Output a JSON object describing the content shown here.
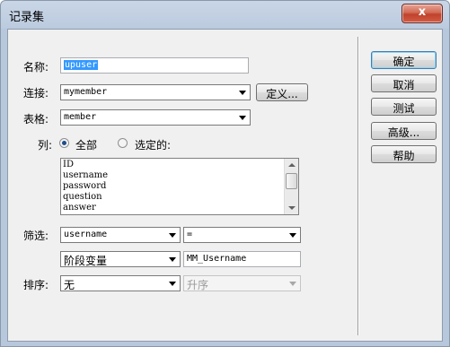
{
  "window": {
    "title": "记录集",
    "close_glyph": "x"
  },
  "form": {
    "name_label": "名称:",
    "name_value": "upuser",
    "connection_label": "连接:",
    "connection_value": "mymember",
    "define_button": "定义...",
    "table_label": "表格:",
    "table_value": "member",
    "columns_label": "列:",
    "radio_all": "全部",
    "radio_selected": "选定的:",
    "columns_list": [
      "ID",
      "username",
      "password",
      "question",
      "answer"
    ],
    "filter_label": "筛选:",
    "filter_column": "username",
    "filter_operator": "=",
    "filter_source": "阶段变量",
    "filter_value": "MM_Username",
    "sort_label": "排序:",
    "sort_column": "无",
    "sort_order": "升序"
  },
  "buttons": {
    "ok": "确定",
    "cancel": "取消",
    "test": "测试",
    "advanced": "高级...",
    "help": "帮助"
  }
}
